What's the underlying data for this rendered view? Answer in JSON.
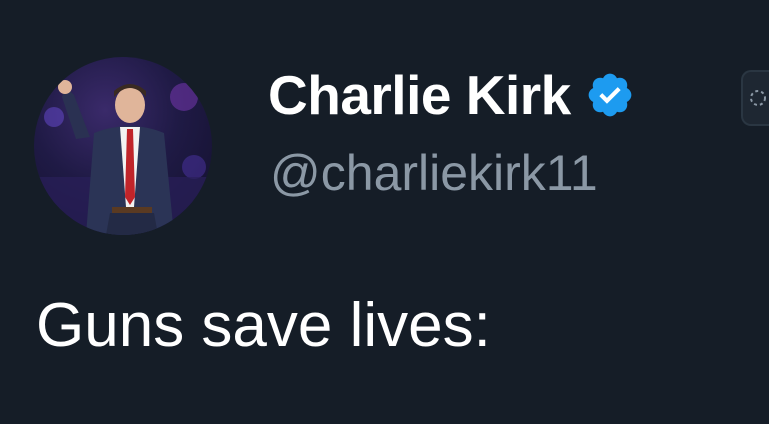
{
  "author": {
    "display_name": "Charlie Kirk",
    "handle": "@charliekirk11",
    "verified": true,
    "avatar_icon": "profile-photo"
  },
  "tweet": {
    "text": "Guns save lives:"
  },
  "colors": {
    "background": "#151d27",
    "name": "#ffffff",
    "handle": "#8b98a5",
    "verified_badge": "#1d9bf0"
  }
}
